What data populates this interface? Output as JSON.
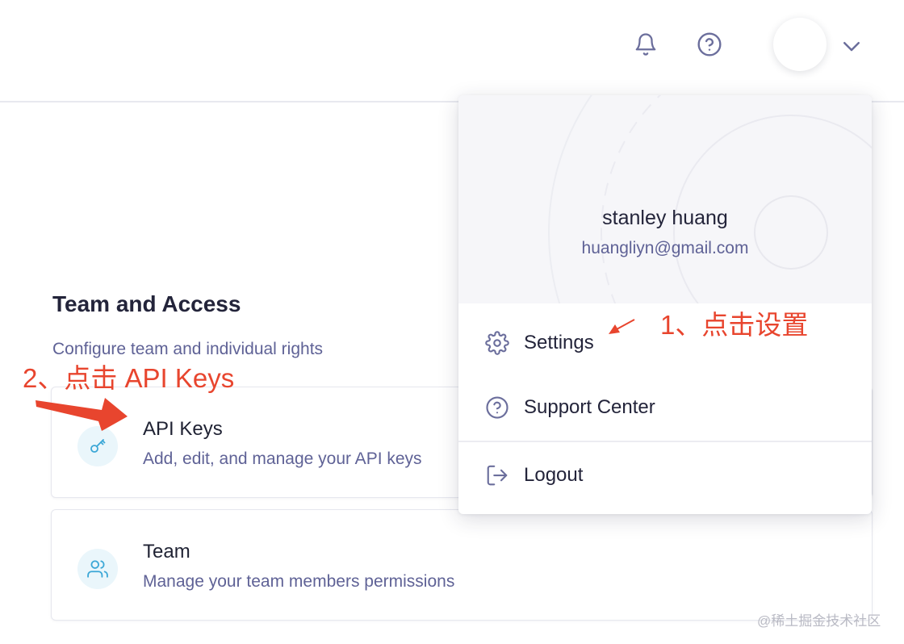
{
  "header": {
    "icons": {
      "notifications": "bell-icon",
      "help": "question-circle-icon",
      "menu_toggle": "chevron-down-icon"
    }
  },
  "section": {
    "title": "Team and Access",
    "description": "Configure team and individual rights"
  },
  "cards": [
    {
      "title": "API Keys",
      "description": "Add, edit, and manage your API keys",
      "icon": "key-icon"
    },
    {
      "title": "Team",
      "description": "Manage your team members permissions",
      "icon": "users-icon"
    }
  ],
  "dropdown": {
    "user_name": "stanley huang",
    "user_email": "huangliyn@gmail.com",
    "items": [
      {
        "label": "Settings",
        "icon": "gear-icon"
      },
      {
        "label": "Support Center",
        "icon": "question-circle-icon"
      },
      {
        "label": "Logout",
        "icon": "logout-icon"
      }
    ]
  },
  "annotations": {
    "step1": "1、点击设置",
    "step2": "2、点击 API Keys"
  },
  "watermark": "@稀土掘金技术社区",
  "colors": {
    "accent_text": "#5f6296",
    "icon_stroke": "#6b6e9c",
    "card_icon": "#3ba7d6",
    "annotation": "#e8452e"
  }
}
